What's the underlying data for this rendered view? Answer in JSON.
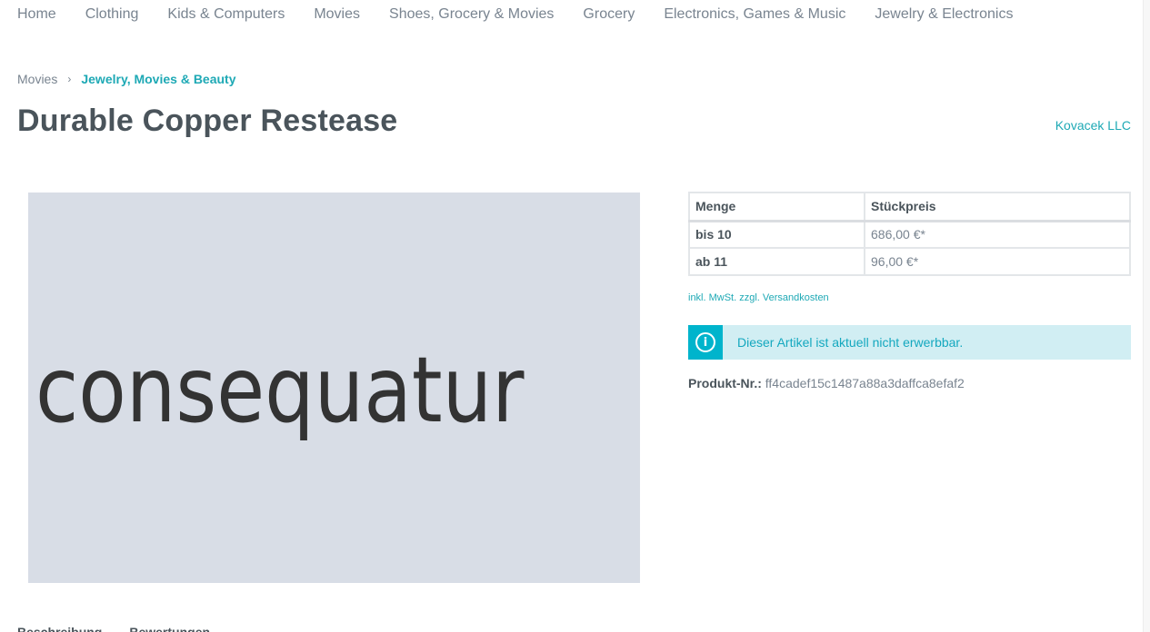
{
  "main_nav": {
    "items": [
      {
        "label": "Home"
      },
      {
        "label": "Clothing"
      },
      {
        "label": "Kids & Computers"
      },
      {
        "label": "Movies"
      },
      {
        "label": "Shoes, Grocery & Movies"
      },
      {
        "label": "Grocery"
      },
      {
        "label": "Electronics, Games & Music"
      },
      {
        "label": "Jewelry & Electronics"
      }
    ]
  },
  "breadcrumb": {
    "items": [
      {
        "label": "Movies"
      },
      {
        "label": "Jewelry, Movies & Beauty"
      }
    ],
    "separator": "›"
  },
  "product": {
    "title": "Durable Copper Restease",
    "manufacturer": "Kovacek LLC",
    "image_text": "consequatur",
    "product_number_label": "Produkt-Nr.:",
    "product_number": "ff4cadef15c1487a88a3daffca8efaf2"
  },
  "price_table": {
    "headers": [
      "Menge",
      "Stückpreis"
    ],
    "rows": [
      {
        "quantity": "bis 10",
        "price": "686,00 €*"
      },
      {
        "quantity": "ab 11",
        "price": "96,00 €*"
      }
    ]
  },
  "tax_info": "inkl. MwSt. zzgl. Versandkosten",
  "alert": {
    "icon": "info-icon",
    "icon_glyph": "i",
    "message": "Dieser Artikel ist aktuell nicht erwerbbar."
  },
  "tabs": [
    {
      "label": "Beschreibung"
    },
    {
      "label": "Bewertungen"
    }
  ]
}
